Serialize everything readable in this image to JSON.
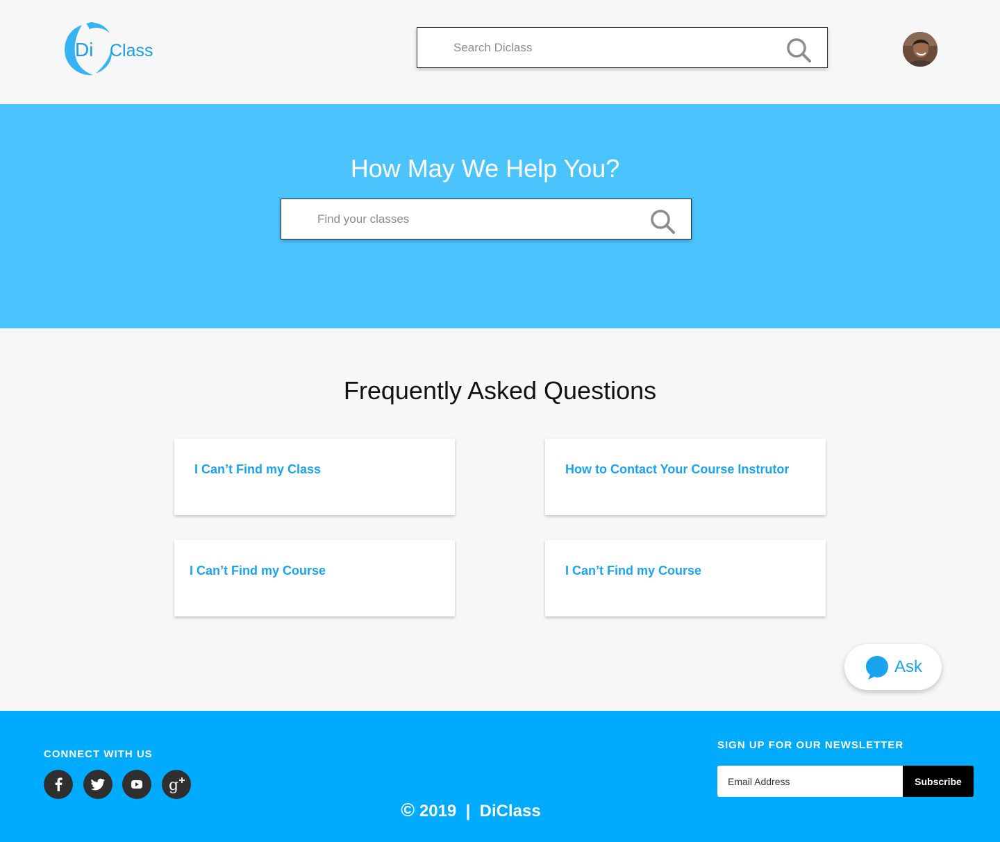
{
  "header": {
    "logo": {
      "di": "Di",
      "class_text": "Class",
      "icon": "diclass-logo"
    },
    "search": {
      "placeholder": "Search Diclass",
      "icon": "search-icon"
    },
    "avatar": {
      "icon": "user-avatar"
    }
  },
  "hero": {
    "title": "How May We Help You?",
    "search": {
      "placeholder": "Find your classes",
      "icon": "search-icon"
    }
  },
  "faq": {
    "title": "Frequently Asked Questions",
    "items": [
      {
        "label": "I Can’t Find my Class"
      },
      {
        "label": "How to Contact Your Course Instrutor"
      },
      {
        "label": "I Can’t Find my Course"
      },
      {
        "label": "I Can’t Find my Course"
      }
    ]
  },
  "ask": {
    "label": "Ask",
    "icon": "chat-bubble-icon"
  },
  "footer": {
    "connect_label": "CONNECT WITH US",
    "social": [
      {
        "name": "facebook-icon"
      },
      {
        "name": "twitter-icon"
      },
      {
        "name": "youtube-icon"
      },
      {
        "name": "google-plus-icon"
      }
    ],
    "newsletter_label": "SIGN UP FOR OUR NEWSLETTER",
    "email_placeholder": "Email Address",
    "subscribe_label": "Subscribe",
    "copyright_symbol": "©",
    "copyright_text": "2019  |  DiClass"
  },
  "colors": {
    "brand_blue": "#1aa3ef",
    "hero_bg": "#4bc3fd",
    "footer_bg": "#00abfd",
    "page_bg": "#f7f7f7",
    "dark": "#2f2f2f"
  }
}
